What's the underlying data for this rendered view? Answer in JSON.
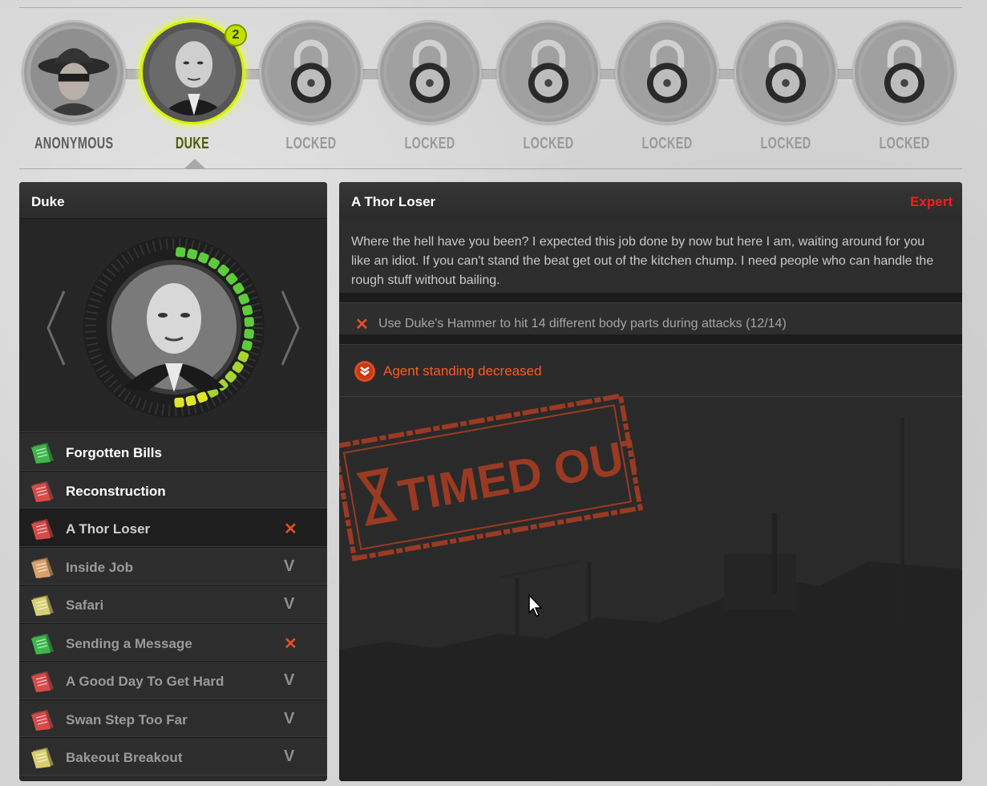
{
  "agents": [
    {
      "label": "ANONYMOUS",
      "state": "unlocked"
    },
    {
      "label": "DUKE",
      "state": "selected",
      "badge": "2"
    },
    {
      "label": "LOCKED",
      "state": "locked"
    },
    {
      "label": "LOCKED",
      "state": "locked"
    },
    {
      "label": "LOCKED",
      "state": "locked"
    },
    {
      "label": "LOCKED",
      "state": "locked"
    },
    {
      "label": "LOCKED",
      "state": "locked"
    },
    {
      "label": "LOCKED",
      "state": "locked"
    }
  ],
  "left_panel": {
    "title": "Duke",
    "standing_progress": 0.5,
    "missions": [
      {
        "name": "Forgotten Bills",
        "doc_color": "#3cb84a",
        "status": ""
      },
      {
        "name": "Reconstruction",
        "doc_color": "#d84a4a",
        "status": ""
      },
      {
        "name": "A Thor Loser",
        "doc_color": "#d84a4a",
        "status": "✕"
      },
      {
        "name": "Inside Job",
        "doc_color": "#d9a06a",
        "status": "V"
      },
      {
        "name": "Safari",
        "doc_color": "#d8d070",
        "status": "V"
      },
      {
        "name": "Sending a Message",
        "doc_color": "#3cb84a",
        "status": "✕"
      },
      {
        "name": "A Good Day To Get Hard",
        "doc_color": "#d84a4a",
        "status": "V"
      },
      {
        "name": "Swan Step Too Far",
        "doc_color": "#d84a4a",
        "status": "V"
      },
      {
        "name": "Bakeout Breakout",
        "doc_color": "#d8d070",
        "status": "V"
      }
    ]
  },
  "right_panel": {
    "title": "A Thor Loser",
    "difficulty": "Expert",
    "briefing": "Where the hell have you been? I expected this job done by now but here I am, waiting around for you like an idiot. If you can't stand the beat get out of the kitchen chump. I need people who can handle the rough stuff without bailing.",
    "objective_mark": "✕",
    "objective": "Use Duke's Hammer to hit 14 different body parts during attacks (12/14)",
    "result": "Agent standing decreased",
    "stamp": "TIMED OUT"
  }
}
